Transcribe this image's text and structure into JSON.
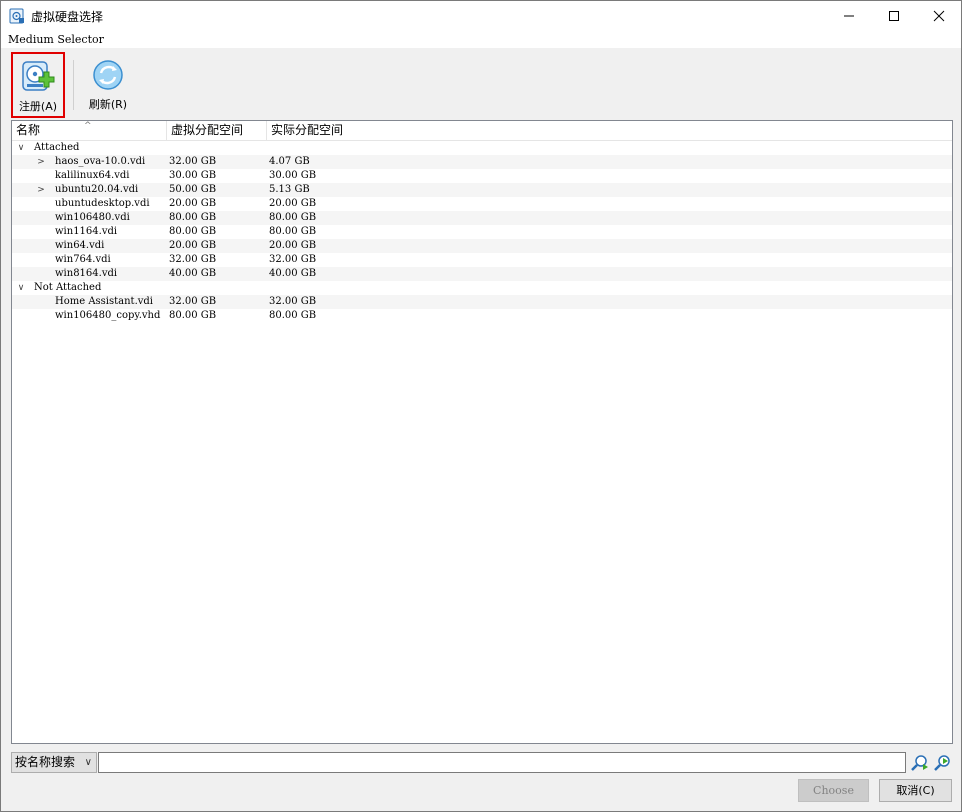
{
  "window": {
    "title": "虚拟硬盘选择",
    "subtitle": "Medium Selector"
  },
  "toolbar": {
    "register_label": "注册(A)",
    "refresh_label": "刷新(R)"
  },
  "table": {
    "columns": [
      "名称",
      "虚拟分配空间",
      "实际分配空间"
    ],
    "groups": [
      {
        "label": "Attached",
        "items": [
          {
            "name": "haos_ova-10.0.vdi",
            "virtual": "32.00 GB",
            "actual": "4.07 GB",
            "expandable": true
          },
          {
            "name": "kalilinux64.vdi",
            "virtual": "30.00 GB",
            "actual": "30.00 GB",
            "expandable": false
          },
          {
            "name": "ubuntu20.04.vdi",
            "virtual": "50.00 GB",
            "actual": "5.13 GB",
            "expandable": true
          },
          {
            "name": "ubuntudesktop.vdi",
            "virtual": "20.00 GB",
            "actual": "20.00 GB",
            "expandable": false
          },
          {
            "name": "win106480.vdi",
            "virtual": "80.00 GB",
            "actual": "80.00 GB",
            "expandable": false
          },
          {
            "name": "win1164.vdi",
            "virtual": "80.00 GB",
            "actual": "80.00 GB",
            "expandable": false
          },
          {
            "name": "win64.vdi",
            "virtual": "20.00 GB",
            "actual": "20.00 GB",
            "expandable": false
          },
          {
            "name": "win764.vdi",
            "virtual": "32.00 GB",
            "actual": "32.00 GB",
            "expandable": false
          },
          {
            "name": "win8164.vdi",
            "virtual": "40.00 GB",
            "actual": "40.00 GB",
            "expandable": false
          }
        ]
      },
      {
        "label": "Not Attached",
        "items": [
          {
            "name": "Home Assistant.vdi",
            "virtual": "32.00 GB",
            "actual": "32.00 GB",
            "expandable": false
          },
          {
            "name": "win106480_copy.vhd",
            "virtual": "80.00 GB",
            "actual": "80.00 GB",
            "expandable": false
          }
        ]
      }
    ]
  },
  "search": {
    "mode": "按名称搜索",
    "value": ""
  },
  "buttons": {
    "choose": "Choose",
    "cancel": "取消(C)"
  },
  "colors": {
    "highlight_border": "#e00000",
    "alt_row": "#f5f5f5",
    "disabled_button": "#cccccc"
  },
  "icons": {
    "app": "medium-selector-icon",
    "register": "hard-disk-add-icon",
    "refresh": "refresh-icon",
    "find_prev": "search-previous-icon",
    "find_next": "search-next-icon"
  }
}
